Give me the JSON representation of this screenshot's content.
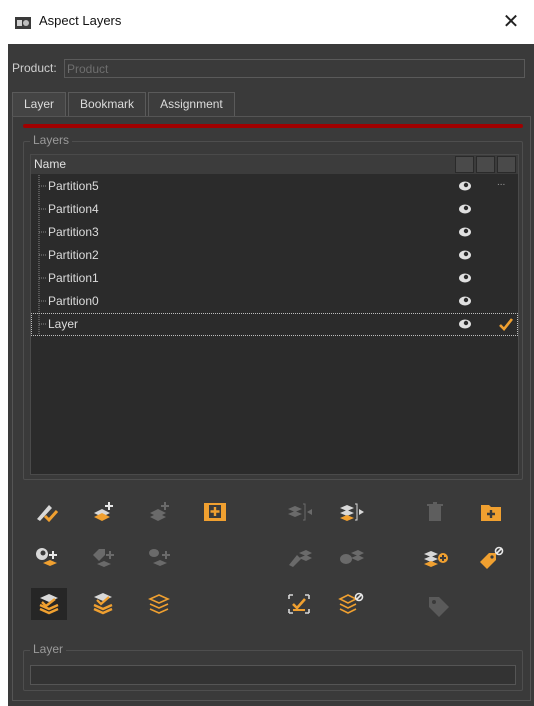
{
  "window": {
    "title": "Aspect Layers",
    "close_label": "✕"
  },
  "product": {
    "label": "Product:",
    "placeholder": "Product",
    "value": ""
  },
  "tabs": [
    {
      "label": "Layer",
      "active": true
    },
    {
      "label": "Bookmark",
      "active": false
    },
    {
      "label": "Assignment",
      "active": false
    }
  ],
  "layers_group": {
    "label": "Layers"
  },
  "tree": {
    "header": {
      "name": "Name"
    },
    "rows": [
      {
        "label": "Partition5",
        "visible": true,
        "extra": "...",
        "current": false
      },
      {
        "label": "Partition4",
        "visible": true,
        "extra": "",
        "current": false
      },
      {
        "label": "Partition3",
        "visible": true,
        "extra": "",
        "current": false
      },
      {
        "label": "Partition2",
        "visible": true,
        "extra": "",
        "current": false
      },
      {
        "label": "Partition1",
        "visible": true,
        "extra": "",
        "current": false
      },
      {
        "label": "Partition0",
        "visible": true,
        "extra": "",
        "current": false
      },
      {
        "label": "Layer",
        "visible": true,
        "extra": "",
        "current": true
      }
    ]
  },
  "toolbar_icons": [
    "pencil-check-icon",
    "add-layer-icon",
    "add-layer-disabled-icon",
    "book-add-icon",
    "layer-move-in-disabled-icon",
    "layer-move-out-icon",
    "delete-icon",
    "folder-add-icon",
    "show-add-icon",
    "tag-add-disabled-icon",
    "show-add-disabled-icon",
    "paint-layer-disabled-icon",
    "show-layer-disabled-icon",
    "layer-add-circle-icon",
    "tag-remove-icon",
    "layers-check-active-icon",
    "layers-check-icon",
    "layers-outline-icon",
    "select-check-icon",
    "layers-remove-icon",
    "tag-disabled-icon"
  ],
  "layer_group": {
    "label": "Layer",
    "value": ""
  },
  "colors": {
    "accent": "#f0a030",
    "red_bar": "#a00000",
    "panel": "#3a3a3a",
    "tree_bg": "#2b2b2b"
  }
}
